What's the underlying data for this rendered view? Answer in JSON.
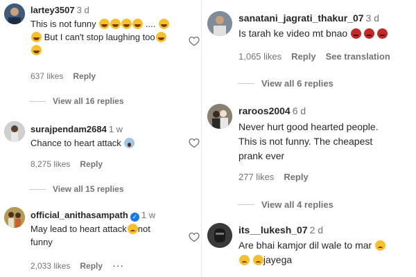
{
  "left_comments": [
    {
      "username": "lartey3507",
      "time": "3 d",
      "text_line1": "This is not funny",
      "text_line1_suffix": " ....",
      "text_line2": " But I can't stop laughing too",
      "likes": "637 likes",
      "reply": "Reply",
      "view_replies": "View all 16 replies",
      "avatar_color": "#2a3a5a"
    },
    {
      "username": "surajpendam2684",
      "time": "1 w",
      "text": "Chance to heart attack",
      "likes": "8,275 likes",
      "reply": "Reply",
      "view_replies": "View all 15 replies",
      "avatar_color": "#9a9a9a"
    },
    {
      "username": "official_anithasampath",
      "time": "1 w",
      "text_line1": "May lead to heart attack",
      "text_line1_suffix": "not",
      "text_line2": "funny",
      "likes": "2,033 likes",
      "reply": "Reply",
      "more": "···",
      "avatar_color": "#8a6a2a"
    }
  ],
  "right_comments": [
    {
      "username": "sanatani_jagrati_thakur_07",
      "time": "3 d",
      "text": "Is tarah ke video mt bnao",
      "likes": "1,065 likes",
      "reply": "Reply",
      "translation": "See translation",
      "view_replies": "View all 6 replies",
      "avatar_color": "#6e7a8a"
    },
    {
      "username": "raroos2004",
      "time": "6 d",
      "text_line1": "Never hurt good hearted people.",
      "text_line2": "This is not funny. The cheapest",
      "text_line3": "prank ever",
      "likes": "277 likes",
      "reply": "Reply",
      "view_replies": "View all 4 replies",
      "avatar_color": "#5a4a4a"
    },
    {
      "username": "its__lukesh_07",
      "time": "2 d",
      "text_line1": "Are bhai kamjor dil wale to mar",
      "text_line2": "jayega",
      "avatar_color": "#2a2a2a"
    }
  ],
  "colors": {
    "text": "#262626",
    "secondary": "#737373",
    "verified": "#1877f2"
  }
}
